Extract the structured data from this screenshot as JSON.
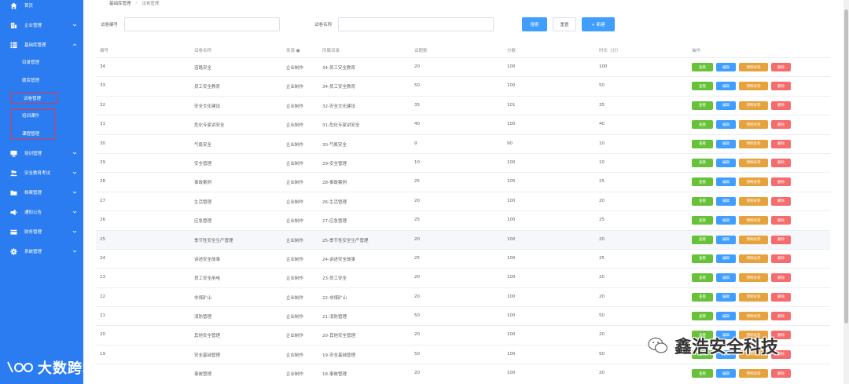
{
  "sidebar": {
    "items": [
      {
        "label": "首页",
        "icon": "home-icon"
      },
      {
        "label": "企业管理",
        "icon": "building-icon"
      },
      {
        "label": "基础库管理",
        "icon": "list-icon"
      },
      {
        "label": "培训管理",
        "icon": "monitor-icon"
      },
      {
        "label": "安全教育考试",
        "icon": "users-icon"
      },
      {
        "label": "档案管理",
        "icon": "folder-icon"
      },
      {
        "label": "通知公告",
        "icon": "megaphone-icon"
      },
      {
        "label": "财务管理",
        "icon": "card-icon"
      },
      {
        "label": "系统管理",
        "icon": "gear-icon"
      }
    ],
    "sub_items": [
      "目录管理",
      "题库管理",
      "试卷管理",
      "培训课件",
      "课程管理"
    ]
  },
  "breadcrumb": {
    "parent": "基础库管理",
    "current": "试卷管理"
  },
  "filters": {
    "code_label": "试卷编号",
    "code_value": "",
    "name_label": "试卷名称",
    "name_value": "",
    "search_label": "搜索",
    "reset_label": "重置",
    "add_label": "+ 新建"
  },
  "table": {
    "headers": [
      "编号",
      "试卷名称",
      "来源",
      "所属目录",
      "试题数",
      "分数",
      "时长（分）",
      "操作"
    ],
    "ops": [
      "查看",
      "编辑",
      "预制试卷",
      "删除"
    ],
    "rows": [
      {
        "id": "34",
        "name": "道路安全",
        "source": "企业制作",
        "dir": "34-员工安全教育",
        "count": "20",
        "score": "100",
        "duration": "100"
      },
      {
        "id": "33",
        "name": "员工安全教育",
        "source": "企业制作",
        "dir": "34-员工安全教育",
        "count": "50",
        "score": "100",
        "duration": "50"
      },
      {
        "id": "32",
        "name": "安全文化建设",
        "source": "企业制作",
        "dir": "32-安全文化建设",
        "count": "35",
        "score": "101",
        "duration": "35"
      },
      {
        "id": "31",
        "name": "危化专家讲安全",
        "source": "企业制作",
        "dir": "31-危化专家讲安全",
        "count": "40",
        "score": "100",
        "duration": "40"
      },
      {
        "id": "30",
        "name": "气瓶安全",
        "source": "企业制作",
        "dir": "30-气瓶安全",
        "count": "9",
        "score": "90",
        "duration": "10"
      },
      {
        "id": "29",
        "name": "安全管理",
        "source": "企业制作",
        "dir": "29-安全管理",
        "count": "10",
        "score": "100",
        "duration": "10"
      },
      {
        "id": "28",
        "name": "事故案例",
        "source": "企业制作",
        "dir": "28-事故案例",
        "count": "25",
        "score": "105",
        "duration": "25"
      },
      {
        "id": "27",
        "name": "生活管理",
        "source": "企业制作",
        "dir": "26-生活管理",
        "count": "20",
        "score": "100",
        "duration": "20"
      },
      {
        "id": "26",
        "name": "应急管理",
        "source": "企业制作",
        "dir": "27-应急管理",
        "count": "25",
        "score": "100",
        "duration": "25"
      },
      {
        "id": "25",
        "name": "季节性安全生产管理",
        "source": "企业制作",
        "dir": "25-季节性安全生产管理",
        "count": "20",
        "score": "100",
        "duration": "20"
      },
      {
        "id": "24",
        "name": "讲述安全故事",
        "source": "企业制作",
        "dir": "24-讲述安全故事",
        "count": "25",
        "score": "100",
        "duration": "25"
      },
      {
        "id": "23",
        "name": "员工安全用电",
        "source": "企业制作",
        "dir": "23-员工安全",
        "count": "20",
        "score": "100",
        "duration": "20"
      },
      {
        "id": "22",
        "name": "非煤矿山",
        "source": "企业制作",
        "dir": "22-非煤矿山",
        "count": "20",
        "score": "100",
        "duration": "20"
      },
      {
        "id": "21",
        "name": "消防管理",
        "source": "企业制作",
        "dir": "21-消防管理",
        "count": "50",
        "score": "100",
        "duration": "50"
      },
      {
        "id": "20",
        "name": "其他安全管理",
        "source": "企业制作",
        "dir": "20-其他安全管理",
        "count": "20",
        "score": "100",
        "duration": "20"
      },
      {
        "id": "19",
        "name": "安全基础管理",
        "source": "企业制作",
        "dir": "19-安全基础管理",
        "count": "50",
        "score": "100",
        "duration": "50"
      },
      {
        "id": "",
        "name": "事故管理",
        "source": "企业制作",
        "dir": "18-事故管理",
        "count": "20",
        "score": "100",
        "duration": "20"
      }
    ]
  },
  "watermarks": {
    "left": "大数跨境",
    "right": "鑫浩安全科技"
  },
  "colors": {
    "sidebar": "#2b7cf0",
    "view": "#67c23a",
    "edit": "#409eff",
    "preset": "#e6a23c",
    "delete": "#f56c6c"
  }
}
